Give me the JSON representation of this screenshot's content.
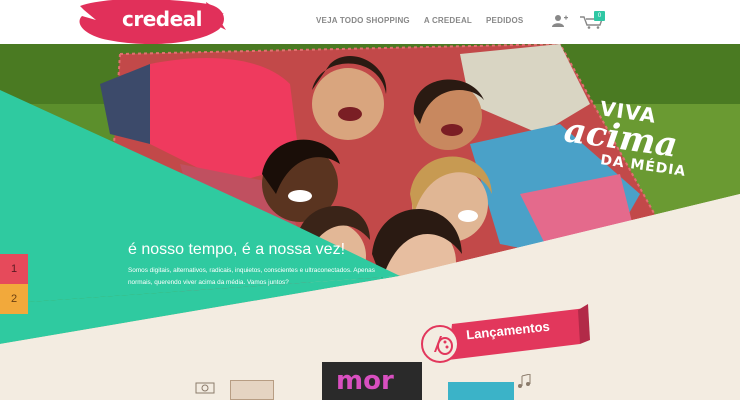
{
  "brand": {
    "logo_text": "credeal",
    "logo_color": "#e1305a"
  },
  "nav": {
    "items": [
      {
        "label": "VEJA TODO SHOPPING"
      },
      {
        "label": "A CREDEAL"
      },
      {
        "label": "PEDIDOS"
      }
    ]
  },
  "header_icons": {
    "user": "add-user-icon",
    "cart": "cart-icon",
    "cart_count": "0"
  },
  "hero": {
    "headline": "é nosso tempo, é a nossa vez!",
    "subtext": "Somos digitais, alternativos, radicais, inquietos, conscientes e ultraconectados. Apenas normais, querendo viver acima da média. Vamos juntos?",
    "slogan": {
      "line1": "VIVA",
      "line2": "acima",
      "line3": "DA MÉDIA"
    },
    "accent_color": "#2fcaa0"
  },
  "slider": {
    "items": [
      {
        "label": "1"
      },
      {
        "label": "2"
      }
    ]
  },
  "section": {
    "title": "Lançamentos",
    "ribbon_color": "#e2375c"
  },
  "products": {
    "featured_label": "mor"
  }
}
